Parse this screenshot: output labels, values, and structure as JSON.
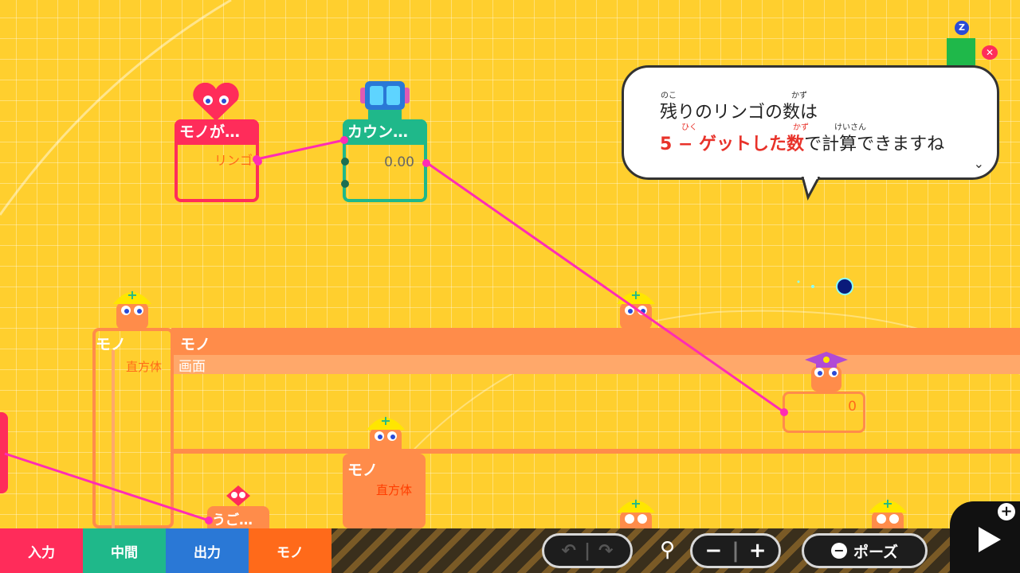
{
  "nodes": {
    "touch": {
      "title": "モノが…",
      "port_label": "リンゴ"
    },
    "counter": {
      "title": "カウン…",
      "value": "0.00"
    },
    "calc": {
      "value": "0"
    },
    "move": {
      "title": "うご…"
    }
  },
  "workers": [
    {
      "name": "モノ",
      "sub": "直方体"
    },
    {
      "name": "モノ",
      "sub": "画面"
    },
    {
      "name": "モノ",
      "sub": "直方体"
    }
  ],
  "bubble": {
    "line1_text": "残りのリンゴの数は",
    "line1_ruby_1": "のこ",
    "line1_ruby_2": "かず",
    "line2_red": "5 − ゲットした数",
    "line2_rest": "で計算できますね",
    "line2_ruby_1": "ひく",
    "line2_ruby_2": "かず",
    "line2_ruby_3": "けいさん"
  },
  "categories": [
    {
      "label": "入力",
      "color": "#ff2c5a"
    },
    {
      "label": "中間",
      "color": "#1fb88a"
    },
    {
      "label": "出力",
      "color": "#2a78d6"
    },
    {
      "label": "モノ",
      "color": "#ff6a1a"
    }
  ],
  "toolbar": {
    "undo_icon": "undo-arrow-icon",
    "redo_icon": "redo-arrow-icon",
    "zoom_icon": "magnifier-icon",
    "zoom_out": "−",
    "zoom_in": "+",
    "pause_label": "ポーズ",
    "pause_prefix": "−",
    "play_plus": "+"
  },
  "marker": {
    "badge": "Z"
  },
  "colors": {
    "background": "#ffcf2e",
    "wire": "#ff2cb4",
    "input": "#ff2c5a",
    "middle": "#1fb88a",
    "output": "#2a78d6",
    "object": "#ff6a1a"
  }
}
